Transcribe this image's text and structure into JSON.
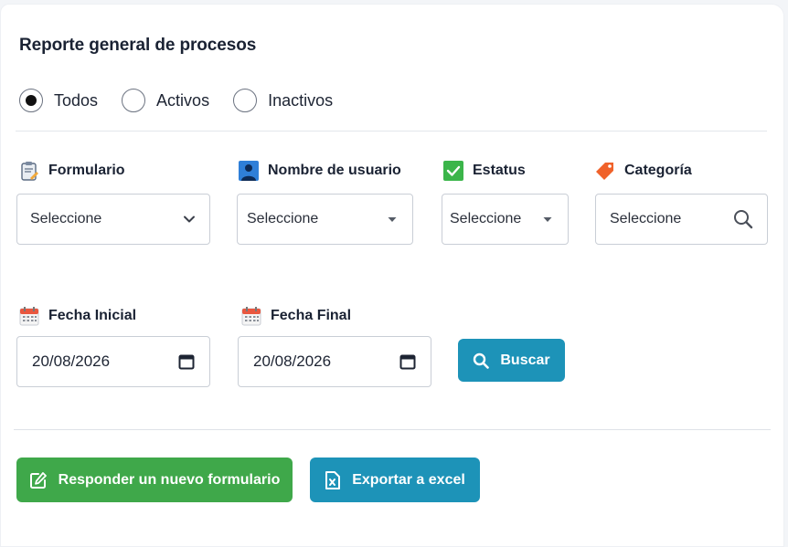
{
  "report": {
    "title": "Reporte general de procesos"
  },
  "status_filter": {
    "options": [
      {
        "label": "Todos",
        "selected": true
      },
      {
        "label": "Activos",
        "selected": false
      },
      {
        "label": "Inactivos",
        "selected": false
      }
    ]
  },
  "filters": {
    "formulario": {
      "label": "Formulario",
      "value": "Seleccione",
      "icon": "clipboard-form-icon"
    },
    "usuario": {
      "label": "Nombre de usuario",
      "value": "Seleccione",
      "icon": "user-icon"
    },
    "estatus": {
      "label": "Estatus",
      "value": "Seleccione",
      "icon": "checkbox-icon"
    },
    "categoria": {
      "label": "Categoría",
      "value": "Seleccione",
      "icon": "tag-icon"
    }
  },
  "dates": {
    "inicial": {
      "label": "Fecha Inicial",
      "value": "20/08/2026",
      "icon": "calendar-icon"
    },
    "final": {
      "label": "Fecha Final",
      "value": "20/08/2026",
      "icon": "calendar-icon"
    }
  },
  "actions": {
    "buscar_label": "Buscar",
    "responder_label": "Responder un nuevo formulario",
    "exportar_label": "Exportar a excel"
  },
  "colors": {
    "primary": "#1d93b8",
    "success": "#3fa84a",
    "border": "#c9ced6"
  }
}
